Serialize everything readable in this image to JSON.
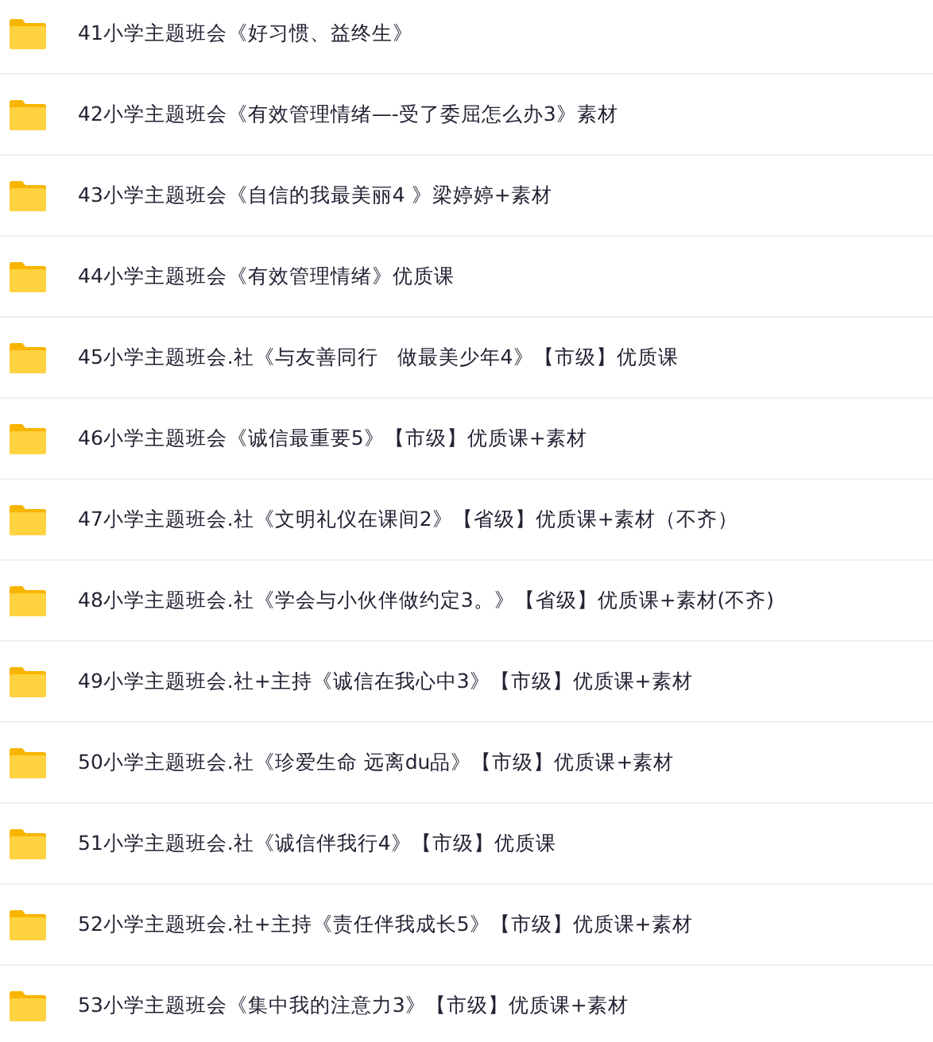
{
  "folders": [
    {
      "name": "41小学主题班会《好习惯、益终生》"
    },
    {
      "name": "42小学主题班会《有效管理情绪—-受了委屈怎么办3》素材"
    },
    {
      "name": "43小学主题班会《自信的我最美丽4 》梁婷婷+素材"
    },
    {
      "name": "44小学主题班会《有效管理情绪》优质课"
    },
    {
      "name": "45小学主题班会.社《与友善同行   做最美少年4》【市级】优质课"
    },
    {
      "name": "46小学主题班会《诚信最重要5》【市级】优质课+素材"
    },
    {
      "name": "47小学主题班会.社《文明礼仪在课间2》【省级】优质课+素材（不齐）"
    },
    {
      "name": "48小学主题班会.社《学会与小伙伴做约定3。》【省级】优质课+素材(不齐)"
    },
    {
      "name": "49小学主题班会.社+主持《诚信在我心中3》【市级】优质课+素材"
    },
    {
      "name": "50小学主题班会.社《珍爱生命 远离du品》【市级】优质课+素材"
    },
    {
      "name": "51小学主题班会.社《诚信伴我行4》【市级】优质课"
    },
    {
      "name": "52小学主题班会.社+主持《责任伴我成长5》【市级】优质课+素材"
    },
    {
      "name": "53小学主题班会《集中我的注意力3》【市级】优质课+素材"
    }
  ]
}
